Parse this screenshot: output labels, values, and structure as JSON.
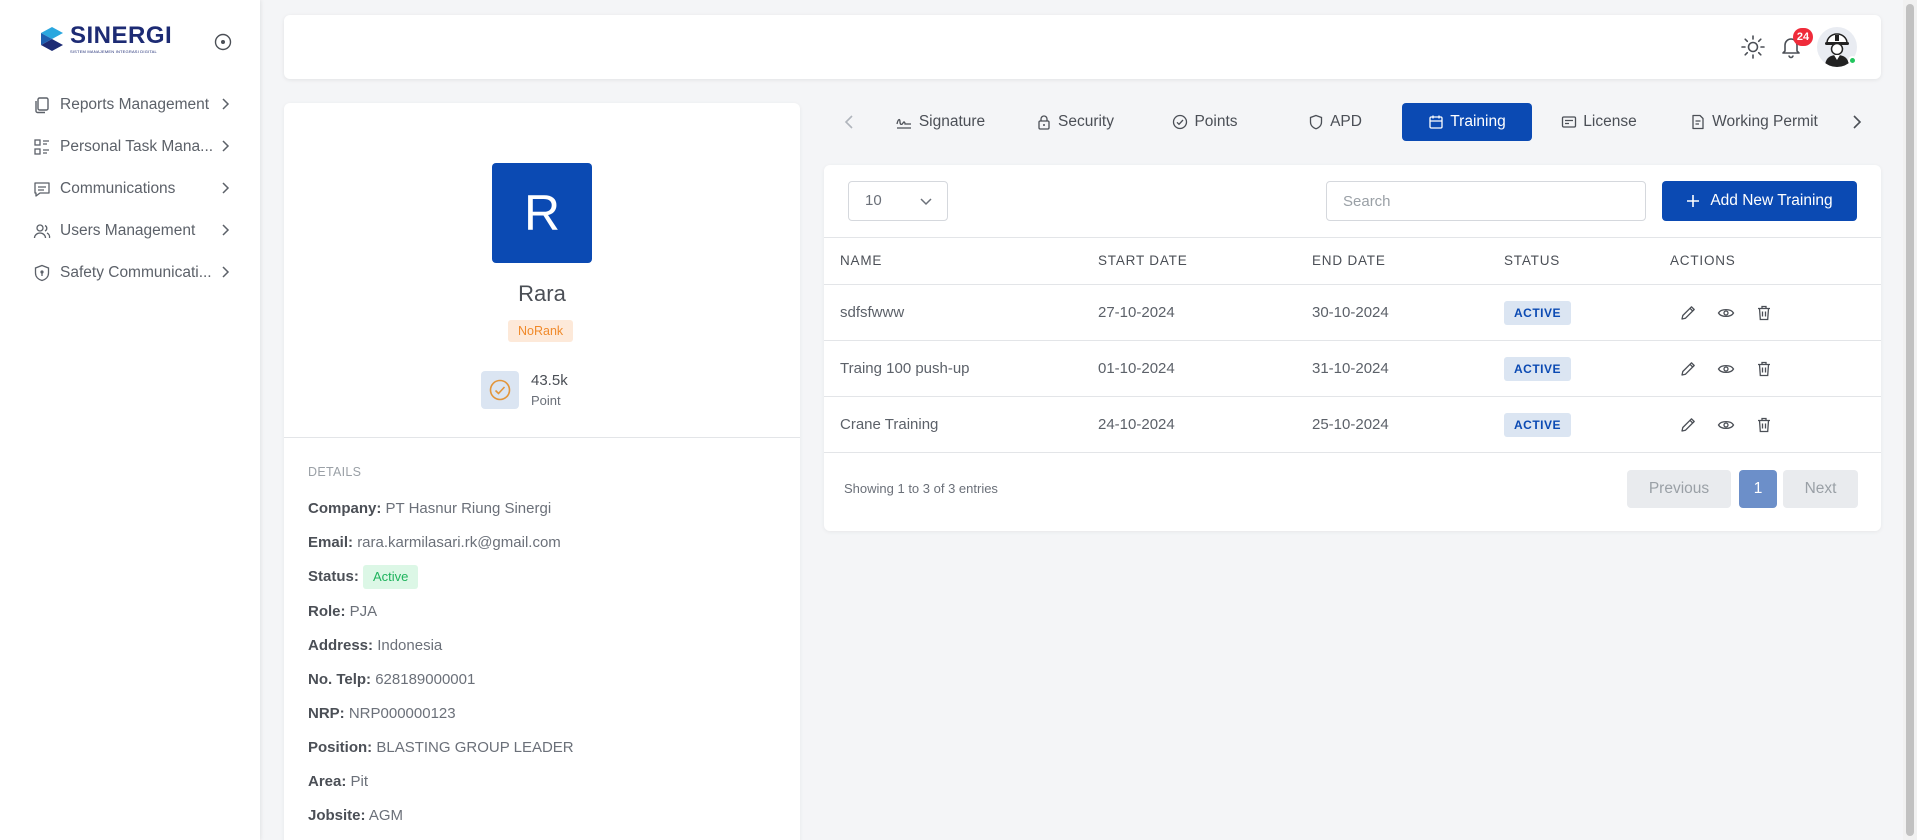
{
  "brand": {
    "name": "SINERGI",
    "tagline": "SISTEM MANAJEMEN INTEGRASI DIGITAL"
  },
  "sidebar": {
    "items": [
      {
        "label": "Reports Management",
        "icon": "documents-icon"
      },
      {
        "label": "Personal Task Mana...",
        "icon": "task-list-icon"
      },
      {
        "label": "Communications",
        "icon": "message-icon"
      },
      {
        "label": "Users Management",
        "icon": "users-icon"
      },
      {
        "label": "Safety Communicati...",
        "icon": "shield-icon"
      }
    ]
  },
  "topbar": {
    "notification_count": "24"
  },
  "profile": {
    "initial": "R",
    "name": "Rara",
    "rank": "NoRank",
    "points_value": "43.5k",
    "points_label": "Point",
    "details_title": "DETAILS",
    "details": [
      {
        "label": "Company:",
        "value": "PT Hasnur Riung Sinergi"
      },
      {
        "label": "Email:",
        "value": "rara.karmilasari.rk@gmail.com"
      },
      {
        "label": "Status:",
        "value": "Active"
      },
      {
        "label": "Role:",
        "value": "PJA"
      },
      {
        "label": "Address:",
        "value": "Indonesia"
      },
      {
        "label": "No. Telp:",
        "value": "628189000001"
      },
      {
        "label": "NRP:",
        "value": "NRP000000123"
      },
      {
        "label": "Position:",
        "value": "BLASTING GROUP LEADER"
      },
      {
        "label": "Area:",
        "value": "Pit"
      },
      {
        "label": "Jobsite:",
        "value": "AGM"
      }
    ]
  },
  "tabs": [
    {
      "label": "Signature",
      "icon": "signature-icon"
    },
    {
      "label": "Security",
      "icon": "lock-icon"
    },
    {
      "label": "Points",
      "icon": "check-circle-icon"
    },
    {
      "label": "APD",
      "icon": "shield-icon"
    },
    {
      "label": "Training",
      "icon": "calendar-icon",
      "active": true
    },
    {
      "label": "License",
      "icon": "id-card-icon"
    },
    {
      "label": "Working Permit",
      "icon": "permit-icon"
    }
  ],
  "table": {
    "page_size": "10",
    "search_placeholder": "Search",
    "add_label": "Add New Training",
    "headers": [
      "NAME",
      "START DATE",
      "END DATE",
      "STATUS",
      "ACTIONS"
    ],
    "rows": [
      {
        "name": "sdfsfwww",
        "start": "27-10-2024",
        "end": "30-10-2024",
        "status": "ACTIVE"
      },
      {
        "name": "Traing 100 push-up",
        "start": "01-10-2024",
        "end": "31-10-2024",
        "status": "ACTIVE"
      },
      {
        "name": "Crane Training",
        "start": "24-10-2024",
        "end": "25-10-2024",
        "status": "ACTIVE"
      }
    ],
    "showing": "Showing 1 to 3 of 3 entries",
    "pagination": {
      "previous": "Previous",
      "current": "1",
      "next": "Next"
    }
  },
  "colors": {
    "primary": "#0b4ab3",
    "badge_red": "#ef2b3a",
    "active_green": "#1fb35d",
    "rank_orange": "#f08a2b"
  }
}
